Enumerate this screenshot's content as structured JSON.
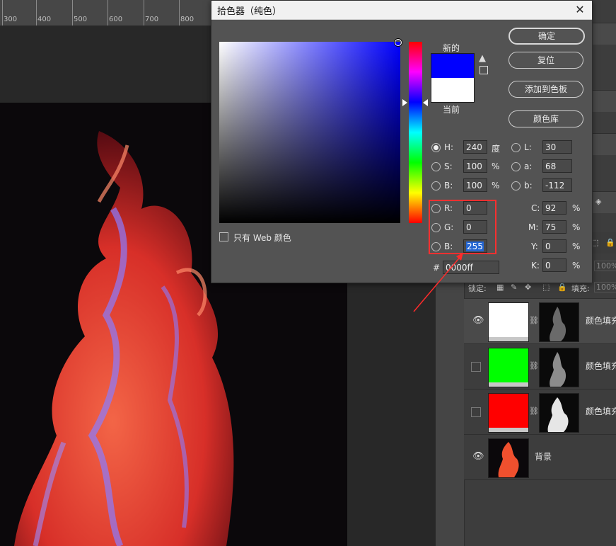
{
  "ruler": {
    "labels": [
      "300",
      "400",
      "500",
      "600",
      "700",
      "800"
    ]
  },
  "dialog": {
    "title": "拾色器（纯色）",
    "close_glyph": "✕",
    "label_new": "新的",
    "label_current": "当前",
    "buttons": {
      "ok": "确定",
      "reset": "复位",
      "add_swatch": "添加到色板",
      "libraries": "颜色库"
    },
    "hsb": {
      "h": {
        "label": "H:",
        "value": "240",
        "unit": "度"
      },
      "s": {
        "label": "S:",
        "value": "100",
        "unit": "%"
      },
      "b": {
        "label": "B:",
        "value": "100",
        "unit": "%"
      }
    },
    "lab": {
      "l": {
        "label": "L:",
        "value": "30"
      },
      "a": {
        "label": "a:",
        "value": "68"
      },
      "b": {
        "label": "b:",
        "value": "-112"
      }
    },
    "rgb": {
      "r": {
        "label": "R:",
        "value": "0"
      },
      "g": {
        "label": "G:",
        "value": "0"
      },
      "b": {
        "label": "B:",
        "value": "255"
      }
    },
    "cmyk": {
      "c": {
        "label": "C:",
        "value": "92",
        "unit": "%"
      },
      "m": {
        "label": "M:",
        "value": "75",
        "unit": "%"
      },
      "y": {
        "label": "Y:",
        "value": "0",
        "unit": "%"
      },
      "k": {
        "label": "K:",
        "value": "0",
        "unit": "%"
      }
    },
    "hex": {
      "label": "#",
      "value": "0000ff"
    },
    "web_only_label": "只有 Web 颜色",
    "new_color": "#0000ff",
    "current_color": "#ffffff"
  },
  "panel": {
    "lock_label": "锁定:",
    "fill_label": "填充:",
    "opacity_value": "100%",
    "fill_value": "100%"
  },
  "layers": [
    {
      "name": "颜色填充",
      "color": "#ffffff",
      "eye": true,
      "selected": true
    },
    {
      "name": "颜色填充",
      "color": "#00ff00",
      "eye": false,
      "selected": false
    },
    {
      "name": "颜色填充",
      "color": "#ff0000",
      "eye": false,
      "selected": false
    },
    {
      "name": "背景",
      "color": "#000000",
      "eye": true,
      "selected": false
    }
  ],
  "icons": {
    "eye": "👁",
    "link": "⛓",
    "warning": "▲"
  }
}
